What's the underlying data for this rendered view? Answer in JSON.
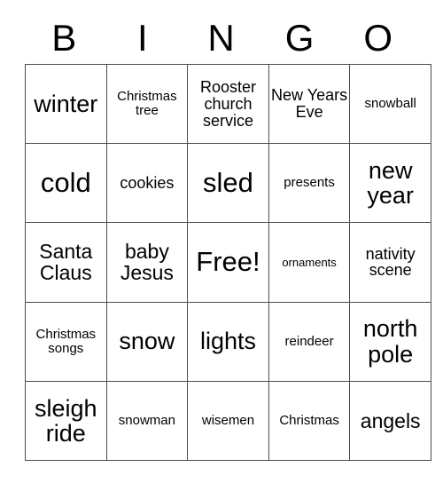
{
  "card": {
    "title": "BINGO",
    "header_letters": [
      "B",
      "I",
      "N",
      "G",
      "O"
    ],
    "colors": {
      "background": "#ffffff",
      "text": "#000000",
      "grid_line": "#4d4d4d"
    },
    "grid": {
      "columns": 5,
      "rows": 5,
      "free_space": "Free!",
      "free_space_position": {
        "row": 3,
        "column": 3
      }
    },
    "cells": [
      [
        {
          "label": "winter",
          "size": "fs-lg"
        },
        {
          "label": "Christmas tree",
          "size": "fs-xs"
        },
        {
          "label": "Rooster church service",
          "size": "fs-sm"
        },
        {
          "label": "New Years Eve",
          "size": "fs-sm"
        },
        {
          "label": "snowball",
          "size": "fs-xs"
        }
      ],
      [
        {
          "label": "cold",
          "size": "fs-xl"
        },
        {
          "label": "cookies",
          "size": "fs-sm"
        },
        {
          "label": "sled",
          "size": "fs-xl"
        },
        {
          "label": "presents",
          "size": "fs-xs"
        },
        {
          "label": "new year",
          "size": "fs-lg"
        }
      ],
      [
        {
          "label": "Santa Claus",
          "size": "fs-md"
        },
        {
          "label": "baby Jesus",
          "size": "fs-md"
        },
        {
          "label": "Free!",
          "size": "fs-xl"
        },
        {
          "label": "ornaments",
          "size": "fs-xxs"
        },
        {
          "label": "nativity scene",
          "size": "fs-sm"
        }
      ],
      [
        {
          "label": "Christmas songs",
          "size": "fs-xs"
        },
        {
          "label": "snow",
          "size": "fs-lg"
        },
        {
          "label": "lights",
          "size": "fs-lg"
        },
        {
          "label": "reindeer",
          "size": "fs-xs"
        },
        {
          "label": "north pole",
          "size": "fs-lg"
        }
      ],
      [
        {
          "label": "sleigh ride",
          "size": "fs-lg"
        },
        {
          "label": "snowman",
          "size": "fs-xs"
        },
        {
          "label": "wisemen",
          "size": "fs-xs"
        },
        {
          "label": "Christmas",
          "size": "fs-xs"
        },
        {
          "label": "angels",
          "size": "fs-md"
        }
      ]
    ]
  }
}
